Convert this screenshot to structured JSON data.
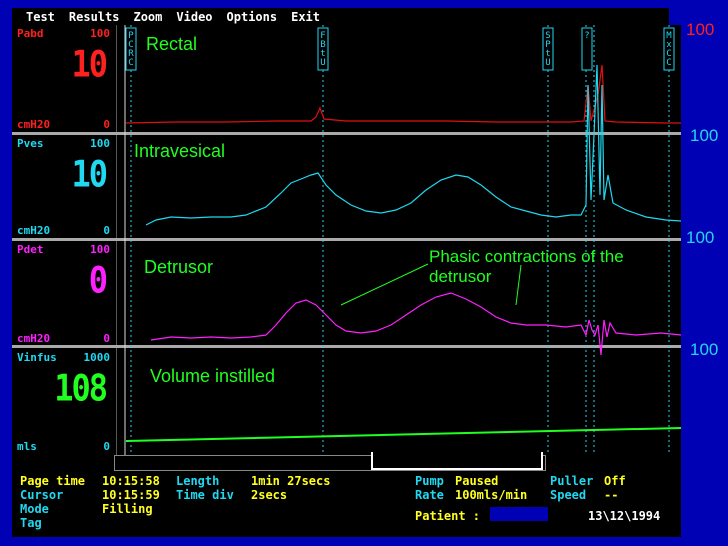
{
  "menu": [
    "Test",
    "Results",
    "Zoom",
    "Video",
    "Options",
    "Exit"
  ],
  "channels": [
    {
      "name": "Pabd",
      "max": "100",
      "unit": "cmH20",
      "min": "0",
      "value": "10",
      "color": "#ff2020",
      "label": "Rectal",
      "right_scale": "100",
      "right_color": "#ff2020"
    },
    {
      "name": "Pves",
      "max": "100",
      "unit": "cmH20",
      "min": "0",
      "value": "10",
      "color": "#20d8f0",
      "label": "Intravesical",
      "right_scale": "100",
      "right_color": "#20d8f0"
    },
    {
      "name": "Pdet",
      "max": "100",
      "unit": "cmH20",
      "min": "0",
      "value": "0",
      "color": "#ff20ff",
      "label": "Detrusor",
      "right_scale": "100",
      "right_color": "#20d8f0"
    },
    {
      "name": "Vinfus",
      "max": "1000",
      "unit": "mls",
      "min": "0",
      "value": "108",
      "color": "#20ff20",
      "label": "Volume instilled",
      "right_scale": "100",
      "right_color": "#20d8f0"
    }
  ],
  "annotation": "Phasic contractions of the detrusor",
  "event_markers": [
    "PCRC",
    "FBtU",
    "SPtU",
    "?",
    "MxCC"
  ],
  "status": {
    "page_time_label": "Page time",
    "page_time": "10:15:58",
    "length_label": "Length",
    "length": "1min 27secs",
    "cursor_label": "Cursor",
    "cursor": "10:15:59",
    "time_div_label": "Time div",
    "time_div": "2secs",
    "mode_label": "Mode",
    "mode": "Filling",
    "tag_label": "Tag",
    "pump_label": "Pump",
    "pump": "Paused",
    "rate_label": "Rate",
    "rate": "100mls/min",
    "puller_label": "Puller",
    "puller": "Off",
    "speed_label": "Speed",
    "speed": "--",
    "patient_label": "Patient :",
    "date": "13\\12\\1994"
  },
  "colors": {
    "menu_bg": "#000000",
    "screen_bg": "#000000",
    "frame": "#0000b4",
    "grid": "#20d8f0"
  }
}
